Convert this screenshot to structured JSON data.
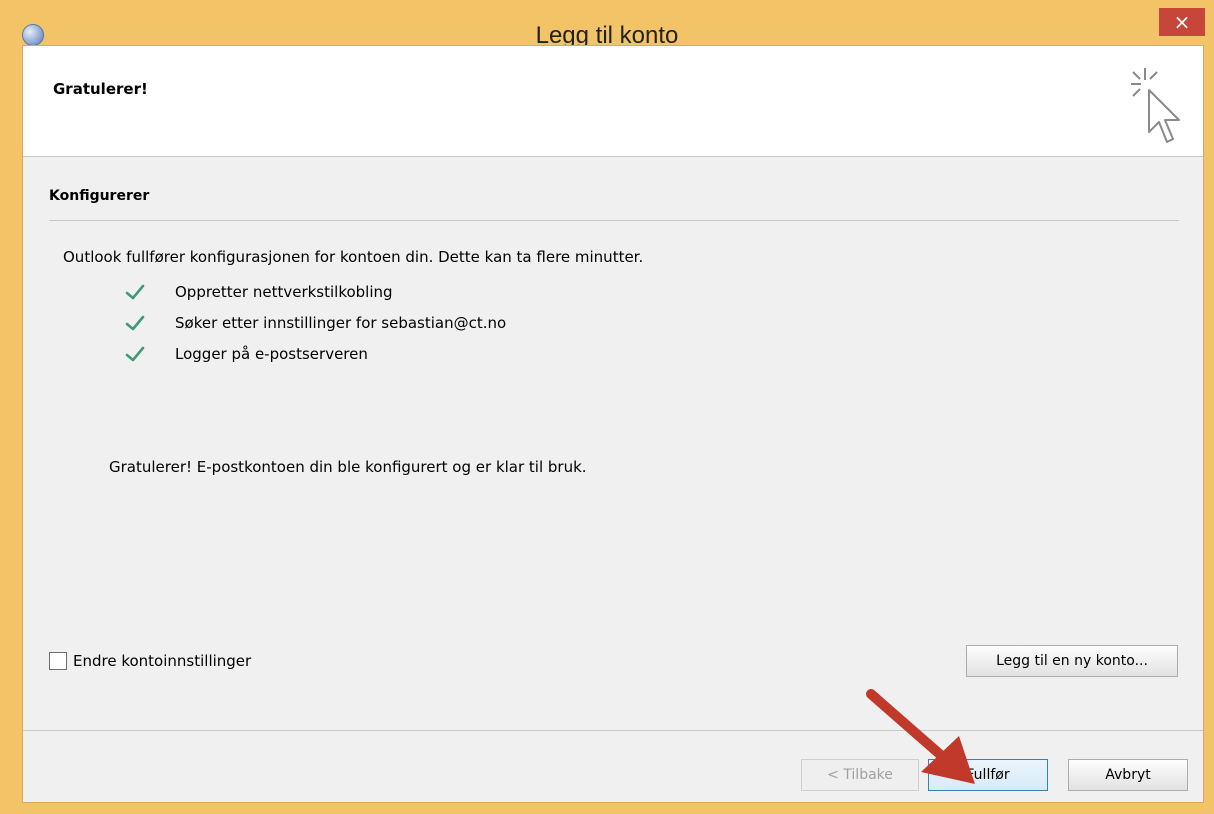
{
  "window": {
    "title": "Legg til konto",
    "close_glyph": "×"
  },
  "header": {
    "title": "Gratulerer!",
    "icon": "cursor-click-icon"
  },
  "section": {
    "title": "Konfigurerer",
    "description": "Outlook fullfører konfigurasjonen for kontoen din. Dette kan ta flere minutter.",
    "steps": [
      {
        "label": "Oppretter nettverkstilkobling",
        "icon": "check-icon"
      },
      {
        "label": "Søker etter innstillinger for sebastian@ct.no",
        "icon": "check-icon"
      },
      {
        "label": "Logger på e-postserveren",
        "icon": "check-icon"
      }
    ],
    "result": "Gratulerer! E-postkontoen din ble konfigurert og er klar til bruk."
  },
  "options": {
    "change_settings_label": "Endre kontoinnstillinger",
    "change_settings_checked": false,
    "add_account_button": "Legg til en ny konto..."
  },
  "footer": {
    "back_button": "< Tilbake",
    "finish_button": "Fullfør",
    "cancel_button": "Avbryt"
  },
  "colors": {
    "title_bar": "#f3c368",
    "close_button": "#c7463a",
    "check": "#3f9a78",
    "annotation_arrow": "#c0392b"
  }
}
